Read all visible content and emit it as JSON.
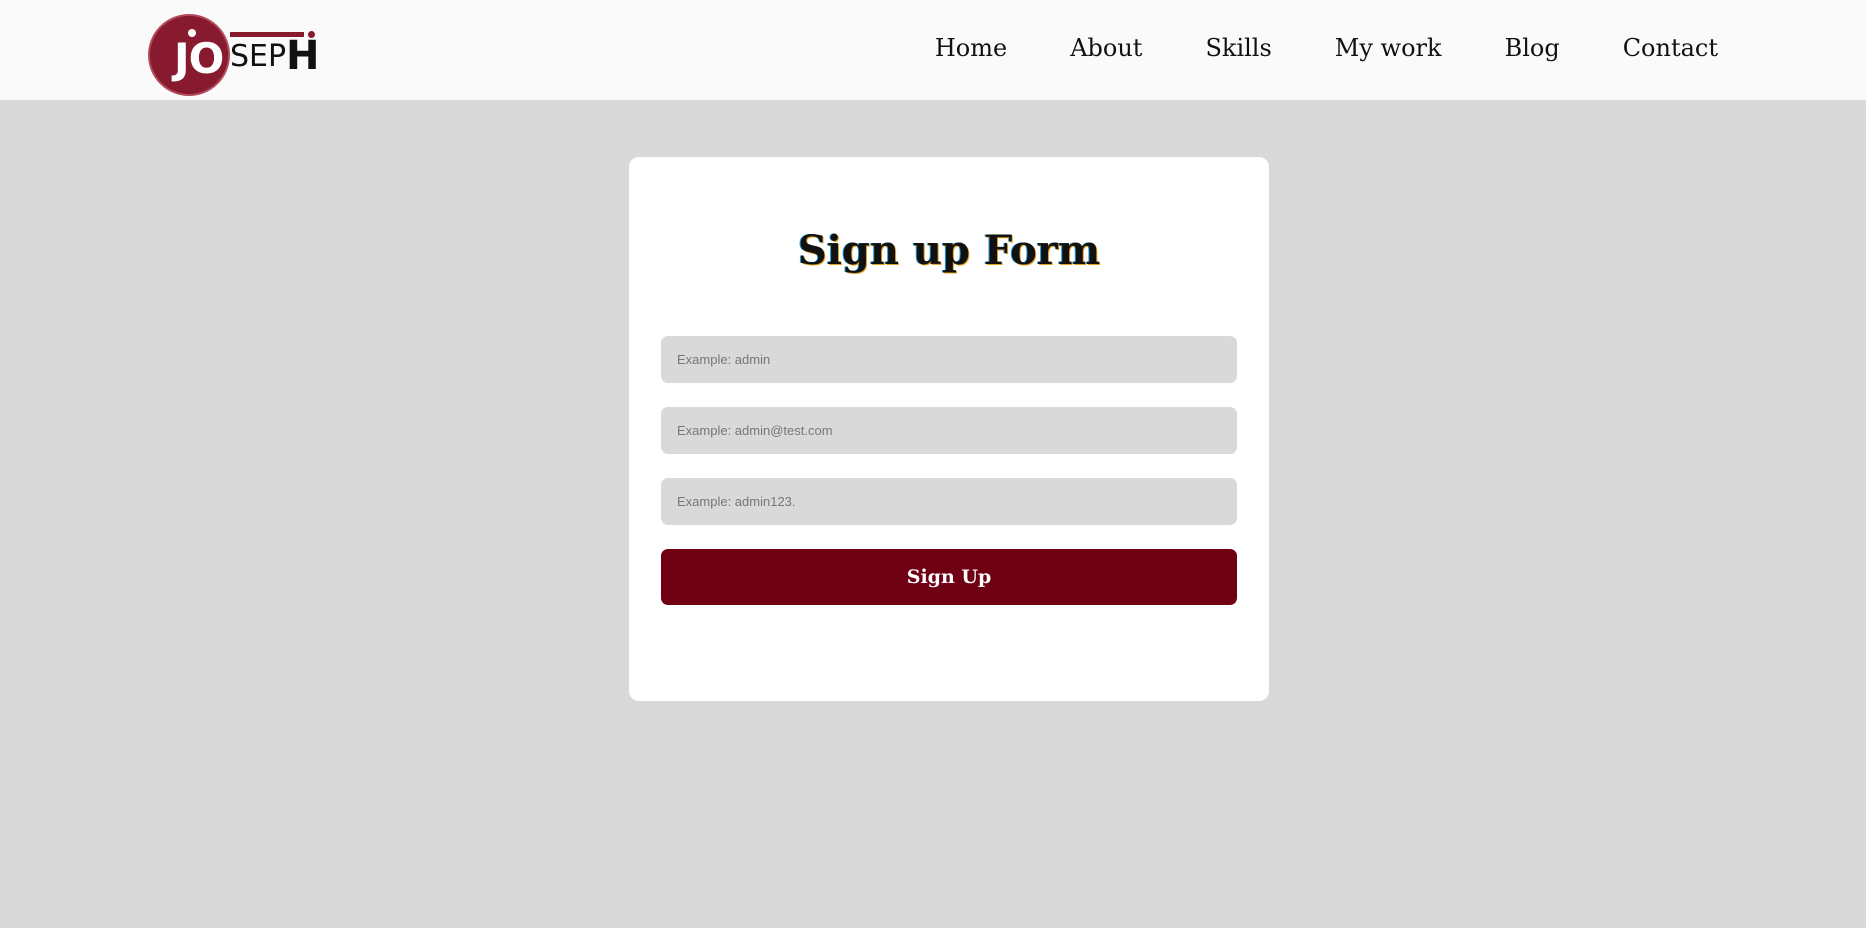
{
  "header": {
    "logo": {
      "text_jo": "JO",
      "text_sep": "SEP",
      "text_h": "H",
      "accent_color": "#871a2e"
    },
    "nav": [
      {
        "label": "Home"
      },
      {
        "label": "About"
      },
      {
        "label": "Skills"
      },
      {
        "label": "My work"
      },
      {
        "label": "Blog"
      },
      {
        "label": "Contact"
      }
    ]
  },
  "form": {
    "title": "Sign up Form",
    "fields": [
      {
        "placeholder": "Example: admin",
        "value": ""
      },
      {
        "placeholder": "Example: admin@test.com",
        "value": ""
      },
      {
        "placeholder": "Example: admin123.",
        "value": ""
      }
    ],
    "submit_label": "Sign Up",
    "submit_color": "#700014"
  },
  "colors": {
    "page_background": "#d9d9d9",
    "header_background": "#fafafa",
    "card_background": "#ffffff"
  }
}
